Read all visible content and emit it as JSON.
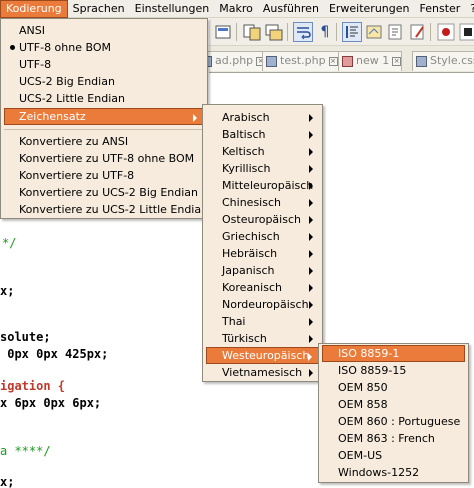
{
  "menubar": {
    "items": [
      "Kodierung",
      "Sprachen",
      "Einstellungen",
      "Makro",
      "Ausführen",
      "Erweiterungen",
      "Fenster",
      "?"
    ],
    "active": "Kodierung"
  },
  "tabs": [
    {
      "label": "ad.php"
    },
    {
      "label": "test.php"
    },
    {
      "label": "new  1"
    },
    {
      "label": "Style.css"
    }
  ],
  "code": {
    "line1": "*/",
    "line2": "x;",
    "line3": "solute;",
    "line4": " 0px 0px 425px;",
    "line5": "igation {",
    "line6": "x 6px 0px 6px;",
    "line7": "a ****/",
    "line8": "x;"
  },
  "menu_kodierung": {
    "group1": [
      "ANSI",
      "UTF-8 ohne BOM",
      "UTF-8",
      "UCS-2 Big Endian",
      "UCS-2 Little Endian"
    ],
    "checked": "UTF-8 ohne BOM",
    "zeichensatz": "Zeichensatz",
    "group2": [
      "Konvertiere zu ANSI",
      "Konvertiere zu UTF-8 ohne BOM",
      "Konvertiere zu UTF-8",
      "Konvertiere zu UCS-2 Big Endian",
      "Konvertiere zu UCS-2 Little Endian"
    ]
  },
  "menu_zeichensatz": {
    "items": [
      "Arabisch",
      "Baltisch",
      "Keltisch",
      "Kyrillisch",
      "Mitteleuropäisch",
      "Chinesisch",
      "Osteuropäisch",
      "Griechisch",
      "Hebräisch",
      "Japanisch",
      "Koreanisch",
      "Nordeuropäisch",
      "Thai",
      "Türkisch",
      "Westeuropäisch",
      "Vietnamesisch"
    ],
    "highlighted": "Westeuropäisch"
  },
  "menu_westeuropaeisch": {
    "items": [
      "ISO 8859-1",
      "ISO 8859-15",
      "OEM 850",
      "OEM 858",
      "OEM 860 : Portuguese",
      "OEM 863 : French",
      "OEM-US",
      "Windows-1252"
    ],
    "highlighted": "ISO 8859-1"
  },
  "colors": {
    "highlight": "#eb7b3b",
    "menu_bg": "#f6ebdc",
    "comment": "#1e9a1e",
    "keyword": "#c0392b"
  }
}
